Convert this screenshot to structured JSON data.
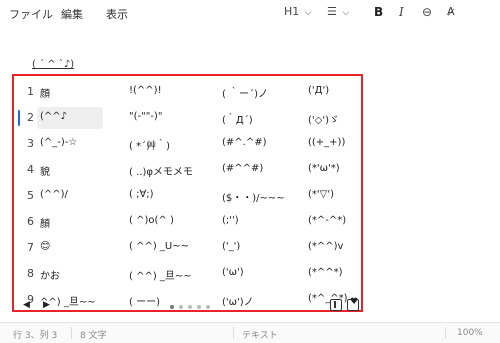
{
  "menubar": {
    "file": "ファイル",
    "edit": "編集",
    "view": "表示"
  },
  "toolbar": {
    "heading": "H1",
    "heading_chevron": "⌵",
    "list_icon": "☰",
    "list_chevron": "⌵",
    "bold": "B",
    "italic": "I",
    "link": "⊖",
    "spell": "A̷"
  },
  "document": {
    "text": "( ´ ^ `♪)"
  },
  "kaomoji": {
    "rows": [
      {
        "num": "1",
        "cells": [
          "顔",
          "!(^^)!",
          "( ｀ー´)ノ",
          "('Д')"
        ]
      },
      {
        "num": "2",
        "cells": [
          "(^^♪",
          "\"(-\"\"-)\"",
          "(｀Д´)",
          "('◇')ゞ"
        ]
      },
      {
        "num": "3",
        "cells": [
          "(^_-)-☆",
          "( *´艸｀)",
          "(#^.^#)",
          "((+_+))"
        ]
      },
      {
        "num": "4",
        "cells": [
          "貌",
          "( ..)φメモメモ",
          "(#^^#)",
          "(*'ω'*)"
        ]
      },
      {
        "num": "5",
        "cells": [
          "(^^)/",
          "( ;∀;)",
          "($・・)/~~~",
          "(*'▽')"
        ]
      },
      {
        "num": "6",
        "cells": [
          "顏",
          "( ^)o(^ )",
          "(;'')",
          "(*^-^*)"
        ]
      },
      {
        "num": "7",
        "cells": [
          "😊",
          "( ^^) _U~~",
          "('_')",
          "(*^^)v"
        ]
      },
      {
        "num": "8",
        "cells": [
          "かお",
          "( ^^) _旦~~",
          "('ω')",
          "(*^^*)"
        ]
      },
      {
        "num": "9",
        "cells": [
          " ^^) _旦~~",
          "( ーー)",
          "('ω')ノ",
          "(*^_^*)"
        ]
      }
    ],
    "selected_row": 2,
    "pager": {
      "prev": "◀",
      "next": "▶",
      "pages": 5,
      "current": 1
    }
  },
  "status": {
    "position": "行 3、列 3",
    "chars": "8 文字",
    "type": "テキスト",
    "zoom": "100%"
  },
  "colors": {
    "highlight_border": "#e8232a",
    "selection_bar": "#1a6ed8"
  }
}
